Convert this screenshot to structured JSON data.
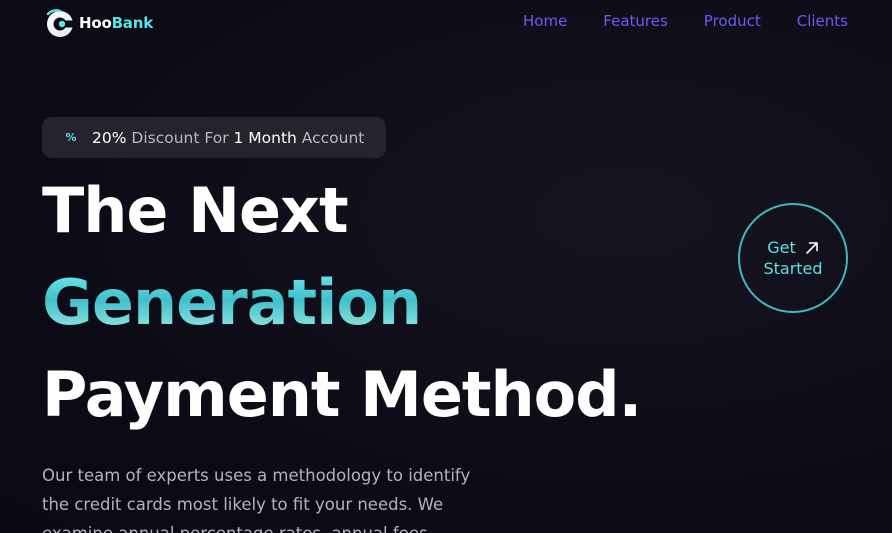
{
  "brand": {
    "name_part1": "Hoo",
    "name_part2": "Bank",
    "accent_color": "#5ce1e6"
  },
  "nav": {
    "items": [
      {
        "label": "Home"
      },
      {
        "label": "Features"
      },
      {
        "label": "Product"
      },
      {
        "label": "Clients"
      }
    ],
    "link_color": "#6a5cf5"
  },
  "badge": {
    "icon": "percent-icon",
    "value": "20%",
    "text_1": " Discount For ",
    "highlight": "1 Month",
    "text_2": " Account"
  },
  "hero": {
    "line_1": "The Next",
    "line_2": "Generation",
    "line_3": "Payment Method."
  },
  "description": "Our team of experts uses a methodology to identify the credit cards most likely to fit your needs. We examine annual percentage rates, annual fees",
  "cta": {
    "line_1": "Get",
    "line_2": "Started",
    "icon": "arrow-up-right-icon"
  }
}
